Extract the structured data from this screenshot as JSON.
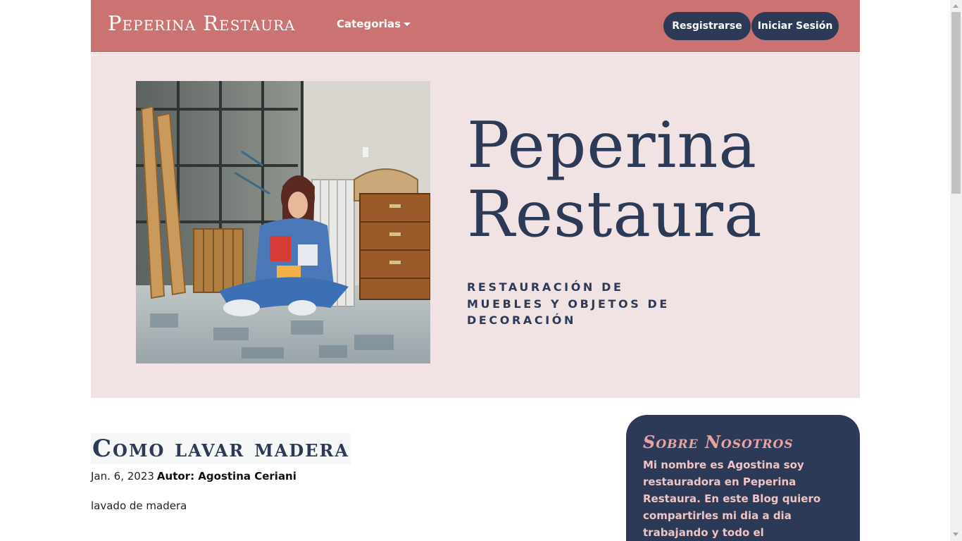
{
  "navbar": {
    "brand": "Peperina Restaura",
    "categories_label": "Categorias",
    "register_label": "Resgistrarse",
    "login_label": "Iniciar Sesión",
    "background_color": "#cb7272",
    "button_color": "#2c3a57"
  },
  "hero": {
    "title_line1": "Peperina",
    "title_line2": "Restaura",
    "subtitle": "Restauración de muebles y objetos de decoración",
    "background_color": "#f1e3e3",
    "photo_icon": "woman-sitting-among-furniture-photo"
  },
  "post": {
    "title": "Como lavar madera",
    "date": "Jan. 6, 2023",
    "author": "Autor: Agostina Ceriani",
    "excerpt": "lavado de madera"
  },
  "sidebar": {
    "about_title": "Sobre Nosotros",
    "about_text": "Mi nombre es Agostina soy restauradora en Peperina Restaura. En este Blog quiero compartirles mi dia a dia trabajando y todo el",
    "card_color": "#2c3a57",
    "accent_color": "#e6a4a4"
  }
}
